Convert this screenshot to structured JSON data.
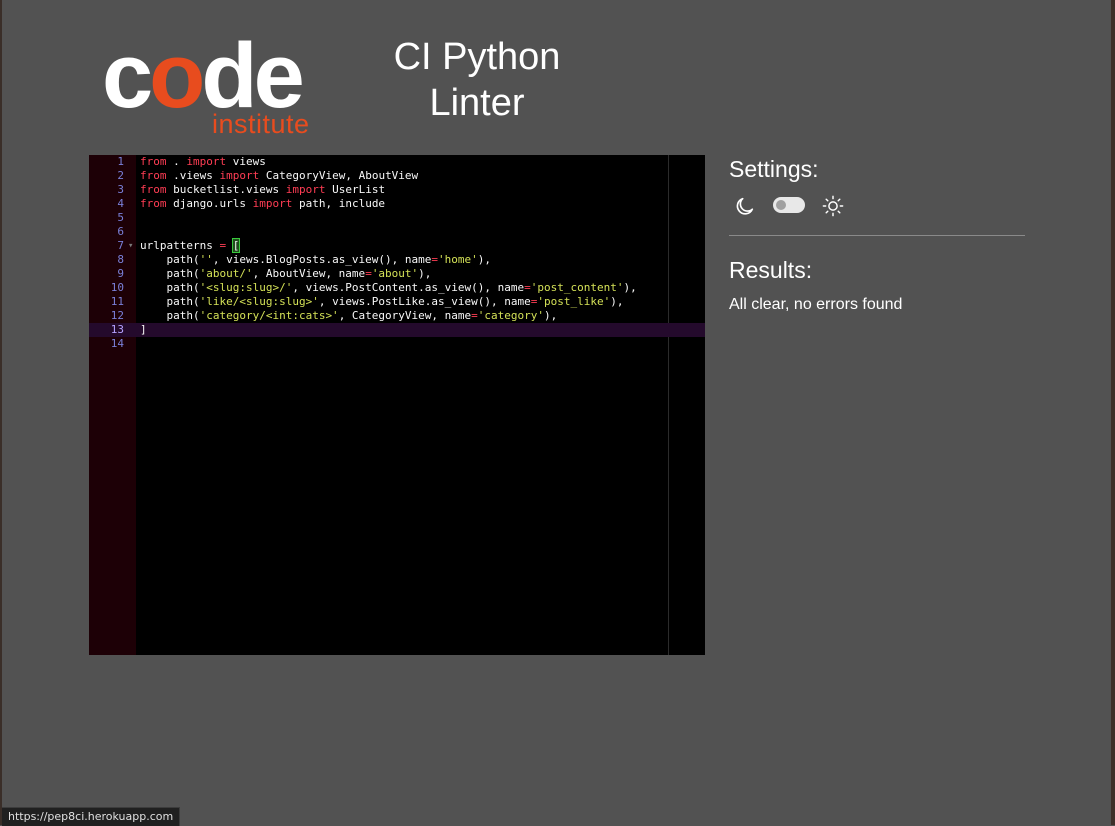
{
  "brand": {
    "logo_main": "code",
    "logo_sub": "institute",
    "accent": "#e84c1e"
  },
  "app": {
    "title": "CI Python Linter"
  },
  "editor": {
    "lines": [
      [
        [
          "kw",
          "from"
        ],
        [
          "id",
          " . "
        ],
        [
          "kw",
          "import"
        ],
        [
          "id",
          " views"
        ]
      ],
      [
        [
          "kw",
          "from"
        ],
        [
          "id",
          " .views "
        ],
        [
          "kw",
          "import"
        ],
        [
          "id",
          " CategoryView, AboutView"
        ]
      ],
      [
        [
          "kw",
          "from"
        ],
        [
          "id",
          " bucketlist.views "
        ],
        [
          "kw",
          "import"
        ],
        [
          "id",
          " UserList"
        ]
      ],
      [
        [
          "kw",
          "from"
        ],
        [
          "id",
          " django.urls "
        ],
        [
          "kw",
          "import"
        ],
        [
          "id",
          " path, include"
        ]
      ],
      [],
      [],
      [
        [
          "id",
          "urlpatterns "
        ],
        [
          "op",
          "="
        ],
        [
          "id",
          " "
        ],
        [
          "br",
          "["
        ]
      ],
      [
        [
          "id",
          "    path("
        ],
        [
          "str",
          "''"
        ],
        [
          "id",
          ", views.BlogPosts.as_view(), name"
        ],
        [
          "op",
          "="
        ],
        [
          "str",
          "'home'"
        ],
        [
          "id",
          "),"
        ]
      ],
      [
        [
          "id",
          "    path("
        ],
        [
          "str",
          "'about/'"
        ],
        [
          "id",
          ", AboutView, name"
        ],
        [
          "op",
          "="
        ],
        [
          "str",
          "'about'"
        ],
        [
          "id",
          "),"
        ]
      ],
      [
        [
          "id",
          "    path("
        ],
        [
          "str",
          "'<slug:slug>/'"
        ],
        [
          "id",
          ", views.PostContent.as_view(), name"
        ],
        [
          "op",
          "="
        ],
        [
          "str",
          "'post_content'"
        ],
        [
          "id",
          "),"
        ]
      ],
      [
        [
          "id",
          "    path("
        ],
        [
          "str",
          "'like/<slug:slug>'"
        ],
        [
          "id",
          ", views.PostLike.as_view(), name"
        ],
        [
          "op",
          "="
        ],
        [
          "str",
          "'post_like'"
        ],
        [
          "id",
          "),"
        ]
      ],
      [
        [
          "id",
          "    path("
        ],
        [
          "str",
          "'category/<int:cats>'"
        ],
        [
          "id",
          ", CategoryView, name"
        ],
        [
          "op",
          "="
        ],
        [
          "str",
          "'category'"
        ],
        [
          "id",
          "),"
        ]
      ],
      [
        [
          "id",
          "]"
        ]
      ],
      []
    ],
    "line_numbers": [
      "1",
      "2",
      "3",
      "4",
      "5",
      "6",
      "7",
      "8",
      "9",
      "10",
      "11",
      "12",
      "13",
      "14"
    ],
    "active_line": 13,
    "fold_line": 7,
    "fold_marker": "▾"
  },
  "settings": {
    "title": "Settings:",
    "dark_icon": "moon-icon",
    "light_icon": "sun-icon",
    "toggle_on": false
  },
  "results": {
    "title": "Results:",
    "message": "All clear, no errors found"
  },
  "status_bar": {
    "url": "https://pep8ci.herokuapp.com"
  }
}
